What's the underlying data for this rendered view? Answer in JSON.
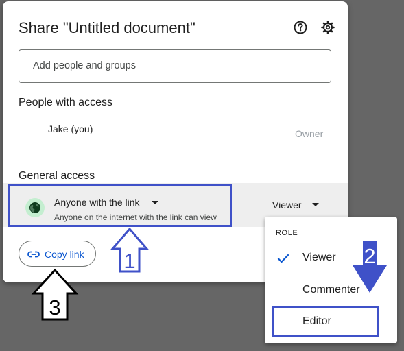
{
  "dialog": {
    "title": "Share \"Untitled document\"",
    "help_icon": "help-circle-icon",
    "settings_icon": "gear-icon",
    "add_placeholder": "Add people and groups"
  },
  "people_section": {
    "heading": "People with access",
    "people": [
      {
        "name": "Jake (you)",
        "role": "Owner"
      }
    ]
  },
  "general_section": {
    "heading": "General access",
    "access_title": "Anyone with the link",
    "access_subtitle": "Anyone on the internet with the link can view",
    "globe_icon": "globe-icon",
    "role_dropdown": "Viewer"
  },
  "copy_link": {
    "label": "Copy link",
    "icon": "link-icon"
  },
  "role_menu": {
    "heading": "ROLE",
    "items": [
      {
        "label": "Viewer",
        "selected": true
      },
      {
        "label": "Commenter",
        "selected": false
      },
      {
        "label": "Editor",
        "selected": false
      }
    ]
  },
  "annotations": {
    "step1": "1",
    "step2": "2",
    "step3": "3"
  },
  "colors": {
    "accent_blue": "#0b57d0",
    "annotation_blue": "#3f51c8",
    "globe_bg": "#c4eed0",
    "backdrop": "#666666"
  }
}
